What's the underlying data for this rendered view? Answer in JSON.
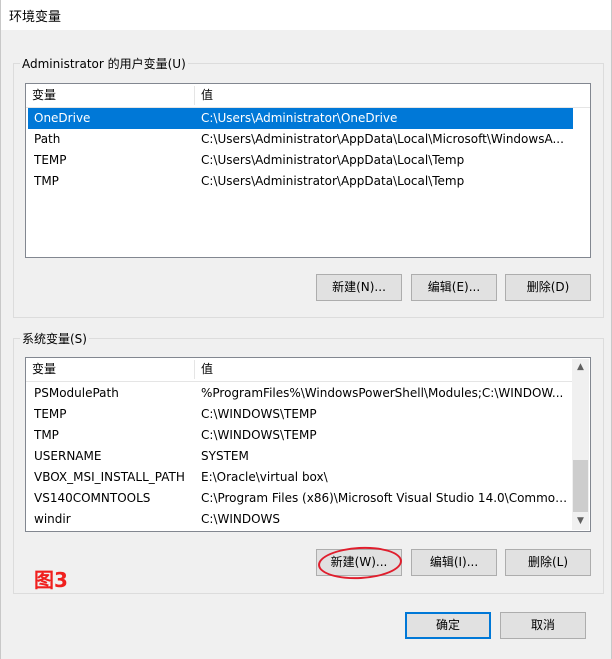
{
  "window": {
    "title": "环境变量"
  },
  "user_vars": {
    "label": "Administrator 的用户变量(U)",
    "columns": [
      "变量",
      "值"
    ],
    "rows": [
      {
        "name": "OneDrive",
        "value": "C:\\Users\\Administrator\\OneDrive",
        "selected": true
      },
      {
        "name": "Path",
        "value": "C:\\Users\\Administrator\\AppData\\Local\\Microsoft\\WindowsA...",
        "selected": false
      },
      {
        "name": "TEMP",
        "value": "C:\\Users\\Administrator\\AppData\\Local\\Temp",
        "selected": false
      },
      {
        "name": "TMP",
        "value": "C:\\Users\\Administrator\\AppData\\Local\\Temp",
        "selected": false
      }
    ],
    "buttons": {
      "new": "新建(N)...",
      "edit": "编辑(E)...",
      "delete": "删除(D)"
    }
  },
  "system_vars": {
    "label": "系统变量(S)",
    "columns": [
      "变量",
      "值"
    ],
    "rows": [
      {
        "name": "PSModulePath",
        "value": "%ProgramFiles%\\WindowsPowerShell\\Modules;C:\\WINDOW..."
      },
      {
        "name": "TEMP",
        "value": "C:\\WINDOWS\\TEMP"
      },
      {
        "name": "TMP",
        "value": "C:\\WINDOWS\\TEMP"
      },
      {
        "name": "USERNAME",
        "value": "SYSTEM"
      },
      {
        "name": "VBOX_MSI_INSTALL_PATH",
        "value": "E:\\Oracle\\virtual box\\"
      },
      {
        "name": "VS140COMNTOOLS",
        "value": "C:\\Program Files (x86)\\Microsoft Visual Studio 14.0\\Common..."
      },
      {
        "name": "windir",
        "value": "C:\\WINDOWS"
      }
    ],
    "buttons": {
      "new": "新建(W)...",
      "edit": "编辑(I)...",
      "delete": "删除(L)"
    }
  },
  "footer": {
    "ok": "确定",
    "cancel": "取消"
  },
  "annotation": {
    "label": "图3",
    "color": "#e01e2d"
  },
  "icons": {
    "scroll_up": "chevron-up-icon",
    "scroll_down": "chevron-down-icon"
  }
}
